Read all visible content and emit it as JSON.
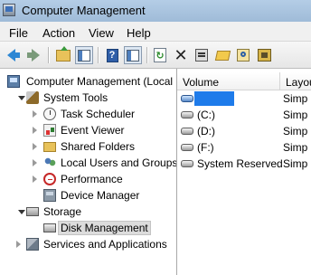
{
  "window": {
    "title": "Computer Management"
  },
  "menu": [
    "File",
    "Action",
    "View",
    "Help"
  ],
  "toolbar": {
    "icons": [
      "back-icon",
      "forward-icon",
      "up-folder-icon",
      "show-hide-tree-icon",
      "help-icon",
      "show-hide-action-pane-icon",
      "refresh-icon",
      "delete-icon",
      "properties-icon",
      "open-icon",
      "search-icon",
      "disk-wizard-icon"
    ]
  },
  "tree": {
    "root": "Computer Management (Local",
    "system_tools": "System Tools",
    "task_scheduler": "Task Scheduler",
    "event_viewer": "Event Viewer",
    "shared_folders": "Shared Folders",
    "local_users": "Local Users and Groups",
    "performance": "Performance",
    "device_manager": "Device Manager",
    "storage": "Storage",
    "disk_management": "Disk Management",
    "services": "Services and Applications"
  },
  "volumes": {
    "columns": [
      "Volume",
      "Layou"
    ],
    "rows": [
      {
        "name": "",
        "layout": "Simp"
      },
      {
        "name": "(C:)",
        "layout": "Simp"
      },
      {
        "name": "(D:)",
        "layout": "Simp"
      },
      {
        "name": "(F:)",
        "layout": "Simp"
      },
      {
        "name": "System Reserved",
        "layout": "Simp"
      }
    ]
  },
  "colors": {
    "selection_redaction": "#1e7bea",
    "titlebar": "#b4cde6"
  }
}
